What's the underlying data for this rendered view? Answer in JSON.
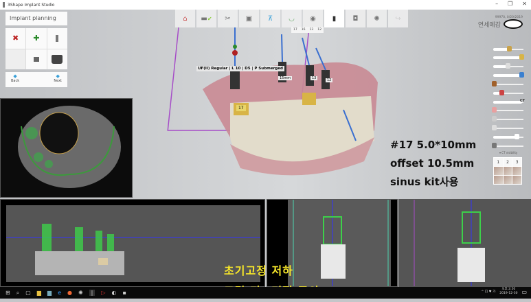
{
  "window": {
    "title": "3Shape Implant Studio",
    "controls": [
      "–",
      "❐",
      "✕"
    ]
  },
  "left_panel": {
    "title": "Implant planning",
    "tools": [
      "delete-implant",
      "add-implant",
      "implant",
      "",
      "abutment",
      "sleeve"
    ],
    "back_label": "Back",
    "next_label": "Next"
  },
  "workflow": {
    "steps": [
      "home",
      "scan-import",
      "segmentation",
      "ct-view",
      "alignment",
      "arch",
      "tooth",
      "implant",
      "abutment",
      "guide",
      "export"
    ],
    "active_index": 7,
    "implant_tabs": [
      "17",
      "16",
      "13",
      "12"
    ]
  },
  "patient": {
    "id": "99970, 0/20/2019",
    "name": "연세예감"
  },
  "viewport": {
    "implant_label": "UF(II) Regular | L 10 | D5 | P Submerged",
    "tooth_tags": [
      "17",
      "15mm",
      "13",
      "12"
    ]
  },
  "sliders": [
    {
      "icon": "crown",
      "value": 0.55
    },
    {
      "icon": "tooth-gold",
      "value": 0.95
    },
    {
      "icon": "tooth-white",
      "value": 0.5
    },
    {
      "icon": "implant-blue",
      "value": 0.95
    },
    {
      "icon": "model",
      "value": 0.05
    },
    {
      "icon": "nerve",
      "value": 0.3
    },
    {
      "icon": "ct",
      "label": "CT",
      "value": 0.95
    },
    {
      "icon": "gingiva",
      "value": 0.05
    },
    {
      "icon": "scan",
      "value": 0.05
    },
    {
      "icon": "jaw",
      "value": 0.05
    },
    {
      "icon": "brightness",
      "value": 0.8
    },
    {
      "icon": "contrast",
      "value": 0.05
    }
  ],
  "ct_visibility_label": "CT visibility",
  "view_buttons": [
    "1",
    "2",
    "3"
  ],
  "annotation": [
    "#17 5.0*10mm",
    "offset 10.5mm",
    "sinus kit사용"
  ],
  "overlay_text": [
    "초기고정 저하",
    "드릴 미끄러짐 주의"
  ],
  "taskbar": {
    "tray_text": "^ 口 ♥ 가",
    "time": "오후 2:50",
    "date": "2019-12-30"
  }
}
